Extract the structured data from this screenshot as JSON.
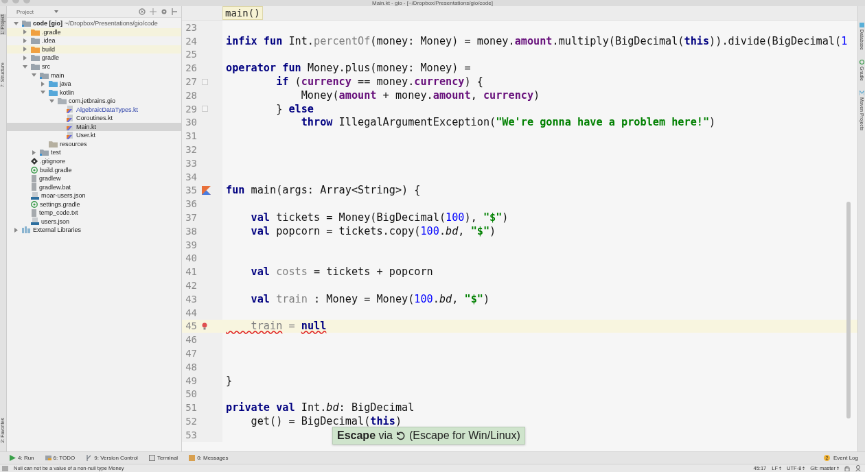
{
  "window": {
    "title": "Main.kt - gio - [~/Dropbox/Presentations/gio/code]"
  },
  "left_strip": [
    {
      "label": "1: Project",
      "selected": true
    },
    {
      "label": "7: Structure",
      "selected": false
    },
    {
      "label": "2: Favorites",
      "selected": false
    }
  ],
  "project_panel": {
    "title": "Project",
    "tree": [
      {
        "label": "code [gio]",
        "path": "~/Dropbox/Presentations/gio/code",
        "kind": "module",
        "expanded": true,
        "selected": false,
        "modified": false,
        "children": [
          {
            "label": ".gradle",
            "kind": "excluded",
            "expanded": false,
            "selected": false,
            "modified": false
          },
          {
            "label": ".idea",
            "kind": "folder",
            "expanded": false,
            "selected": false,
            "modified": false
          },
          {
            "label": "build",
            "kind": "excluded",
            "expanded": false,
            "selected": false,
            "modified": false
          },
          {
            "label": "gradle",
            "kind": "folder",
            "expanded": false,
            "selected": false,
            "modified": false
          },
          {
            "label": "src",
            "kind": "folder",
            "expanded": true,
            "selected": false,
            "modified": false,
            "children": [
              {
                "label": "main",
                "kind": "module",
                "expanded": true,
                "selected": false,
                "modified": false,
                "children": [
                  {
                    "label": "java",
                    "kind": "source",
                    "expanded": false,
                    "selected": false,
                    "modified": false
                  },
                  {
                    "label": "kotlin",
                    "kind": "source",
                    "expanded": true,
                    "selected": false,
                    "modified": false,
                    "children": [
                      {
                        "label": "com.jetbrains.gio",
                        "kind": "package",
                        "expanded": true,
                        "selected": false,
                        "modified": false,
                        "children": [
                          {
                            "label": "AlgebraicDataTypes.kt",
                            "kind": "kotlin",
                            "selected": false,
                            "modified": true
                          },
                          {
                            "label": "Coroutines.kt",
                            "kind": "kotlin",
                            "selected": false,
                            "modified": false
                          },
                          {
                            "label": "Main.kt",
                            "kind": "kotlin",
                            "selected": true,
                            "modified": false
                          },
                          {
                            "label": "User.kt",
                            "kind": "kotlin",
                            "selected": false,
                            "modified": false
                          }
                        ]
                      }
                    ]
                  },
                  {
                    "label": "resources",
                    "kind": "resources",
                    "selected": false,
                    "modified": false
                  }
                ]
              },
              {
                "label": "test",
                "kind": "module",
                "expanded": false,
                "selected": false,
                "modified": false
              }
            ]
          },
          {
            "label": ".gitignore",
            "kind": "git",
            "selected": false,
            "modified": false
          },
          {
            "label": "build.gradle",
            "kind": "gradle",
            "selected": false,
            "modified": false
          },
          {
            "label": "gradlew",
            "kind": "file",
            "selected": false,
            "modified": false
          },
          {
            "label": "gradlew.bat",
            "kind": "file",
            "selected": false,
            "modified": false
          },
          {
            "label": "moar-users.json",
            "kind": "json",
            "selected": false,
            "modified": false
          },
          {
            "label": "settings.gradle",
            "kind": "gradle",
            "selected": false,
            "modified": false
          },
          {
            "label": "temp_code.txt",
            "kind": "file",
            "selected": false,
            "modified": false
          },
          {
            "label": "users.json",
            "kind": "json",
            "selected": false,
            "modified": false
          }
        ]
      },
      {
        "label": "External Libraries",
        "kind": "libraries",
        "expanded": false,
        "selected": false,
        "modified": false
      }
    ]
  },
  "editor": {
    "breadcrumb": "main()",
    "lines": [
      {
        "number": "23",
        "current": false
      },
      {
        "number": "24",
        "current": false,
        "tokens": [
          {
            "kind": "kw",
            "text": "infix fun "
          },
          {
            "kind": "plain",
            "text": "Int."
          },
          {
            "kind": "unused",
            "text": "percentOf"
          },
          {
            "kind": "plain",
            "text": "(money: Money) = money."
          },
          {
            "kind": "prop",
            "text": "amount"
          },
          {
            "kind": "plain",
            "text": ".multiply(BigDecimal("
          },
          {
            "kind": "kw",
            "text": "this"
          },
          {
            "kind": "plain",
            "text": ")).divide(BigDecimal("
          },
          {
            "kind": "num",
            "text": "1"
          }
        ]
      },
      {
        "number": "25",
        "current": false
      },
      {
        "number": "26",
        "current": false,
        "tokens": [
          {
            "kind": "kw",
            "text": "operator fun "
          },
          {
            "kind": "plain",
            "text": "Money.plus(money: Money) ="
          }
        ]
      },
      {
        "number": "27",
        "current": false,
        "marker": {
          "kind": "fold"
        },
        "tokens": [
          {
            "kind": "kw",
            "text": "        if "
          },
          {
            "kind": "plain",
            "text": "("
          },
          {
            "kind": "prop",
            "text": "currency"
          },
          {
            "kind": "plain",
            "text": " == money."
          },
          {
            "kind": "prop",
            "text": "currency"
          },
          {
            "kind": "plain",
            "text": ") {"
          }
        ]
      },
      {
        "number": "28",
        "current": false,
        "tokens": [
          {
            "kind": "plain",
            "text": "            Money("
          },
          {
            "kind": "prop",
            "text": "amount"
          },
          {
            "kind": "plain",
            "text": " + money."
          },
          {
            "kind": "prop",
            "text": "amount"
          },
          {
            "kind": "plain",
            "text": ", "
          },
          {
            "kind": "prop",
            "text": "currency"
          },
          {
            "kind": "plain",
            "text": ")"
          }
        ]
      },
      {
        "number": "29",
        "current": false,
        "marker": {
          "kind": "fold"
        },
        "tokens": [
          {
            "kind": "plain",
            "text": "        } "
          },
          {
            "kind": "kw",
            "text": "else"
          }
        ]
      },
      {
        "number": "30",
        "current": false,
        "tokens": [
          {
            "kind": "kw",
            "text": "            throw "
          },
          {
            "kind": "plain",
            "text": "IllegalArgumentException("
          },
          {
            "kind": "str",
            "text": "\"We're gonna have a problem here!\""
          },
          {
            "kind": "plain",
            "text": ")"
          }
        ]
      },
      {
        "number": "31",
        "current": false
      },
      {
        "number": "32",
        "current": false
      },
      {
        "number": "33",
        "current": false
      },
      {
        "number": "34",
        "current": false
      },
      {
        "number": "35",
        "current": false,
        "marker": {
          "kind": "run"
        },
        "tokens": [
          {
            "kind": "kw",
            "text": "fun "
          },
          {
            "kind": "plain",
            "text": "main(args: Array<String>) {"
          }
        ]
      },
      {
        "number": "36",
        "current": false
      },
      {
        "number": "37",
        "current": false,
        "tokens": [
          {
            "kind": "kw",
            "text": "    val "
          },
          {
            "kind": "plain",
            "text": "tickets = Money(BigDecimal("
          },
          {
            "kind": "num",
            "text": "100"
          },
          {
            "kind": "plain",
            "text": "), "
          },
          {
            "kind": "str",
            "text": "\"$\""
          },
          {
            "kind": "plain",
            "text": ")"
          }
        ]
      },
      {
        "number": "38",
        "current": false,
        "tokens": [
          {
            "kind": "kw",
            "text": "    val "
          },
          {
            "kind": "plain",
            "text": "popcorn = tickets.copy("
          },
          {
            "kind": "num",
            "text": "100"
          },
          {
            "kind": "plain",
            "text": "."
          },
          {
            "kind": "ext",
            "text": "bd"
          },
          {
            "kind": "plain",
            "text": ", "
          },
          {
            "kind": "str",
            "text": "\"$\""
          },
          {
            "kind": "plain",
            "text": ")"
          }
        ]
      },
      {
        "number": "39",
        "current": false
      },
      {
        "number": "40",
        "current": false
      },
      {
        "number": "41",
        "current": false,
        "tokens": [
          {
            "kind": "kw",
            "text": "    val "
          },
          {
            "kind": "unused",
            "text": "costs"
          },
          {
            "kind": "plain",
            "text": " = tickets + popcorn"
          }
        ]
      },
      {
        "number": "42",
        "current": false
      },
      {
        "number": "43",
        "current": false,
        "tokens": [
          {
            "kind": "kw",
            "text": "    val "
          },
          {
            "kind": "unused",
            "text": "train"
          },
          {
            "kind": "plain",
            "text": " : Money = Money("
          },
          {
            "kind": "num",
            "text": "100"
          },
          {
            "kind": "plain",
            "text": "."
          },
          {
            "kind": "ext",
            "text": "bd"
          },
          {
            "kind": "plain",
            "text": ", "
          },
          {
            "kind": "str",
            "text": "\"$\""
          },
          {
            "kind": "plain",
            "text": ")"
          }
        ]
      },
      {
        "number": "44",
        "current": false
      },
      {
        "number": "45",
        "current": true,
        "marker": {
          "kind": "bulb"
        },
        "tokens": [
          {
            "kind": "err",
            "text": "    train"
          },
          {
            "kind": "unused",
            "text": " = "
          },
          {
            "kind": "errkw",
            "text": "null"
          }
        ]
      },
      {
        "number": "46",
        "current": false
      },
      {
        "number": "47",
        "current": false
      },
      {
        "number": "48",
        "current": false
      },
      {
        "number": "49",
        "current": false,
        "tokens": [
          {
            "kind": "plain",
            "text": "}"
          }
        ]
      },
      {
        "number": "50",
        "current": false
      },
      {
        "number": "51",
        "current": false,
        "tokens": [
          {
            "kind": "kw",
            "text": "private val "
          },
          {
            "kind": "plain",
            "text": "Int."
          },
          {
            "kind": "ext",
            "text": "bd"
          },
          {
            "kind": "plain",
            "text": ": BigDecimal"
          }
        ]
      },
      {
        "number": "52",
        "current": false,
        "tokens": [
          {
            "kind": "plain",
            "text": "    get() = BigDecimal("
          },
          {
            "kind": "kw",
            "text": "this"
          },
          {
            "kind": "plain",
            "text": ")"
          }
        ]
      },
      {
        "number": "53",
        "current": false
      }
    ]
  },
  "right_strip": [
    {
      "label": "Database",
      "kind": "database"
    },
    {
      "label": "Gradle",
      "kind": "gradle"
    },
    {
      "label": "Maven Projects",
      "kind": "maven"
    }
  ],
  "tool_windows": [
    {
      "label": "4: Run",
      "kind": "run"
    },
    {
      "label": "6: TODO",
      "kind": "todo"
    },
    {
      "label": "9: Version Control",
      "kind": "vcs"
    },
    {
      "label": "Terminal",
      "kind": "terminal"
    },
    {
      "label": "0: Messages",
      "kind": "messages"
    }
  ],
  "event_log": {
    "label": "Event Log",
    "badge": "2"
  },
  "tooltip": {
    "key": "**Escape** via",
    "alt": "(Escape for Win/Linux)"
  },
  "status_bar": {
    "message": "Null can not be a value of a non-null type Money",
    "position": "45:17",
    "line_separator": "LF",
    "encoding": "UTF-8",
    "branch": "Git: master"
  }
}
